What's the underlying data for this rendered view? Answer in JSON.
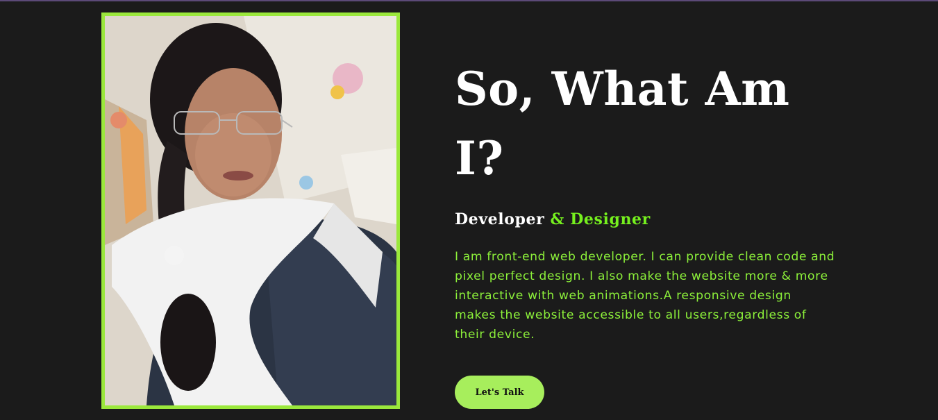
{
  "about": {
    "heading": "So, What Am I?",
    "subtitle_white": "Developer",
    "subtitle_green": "& Designer",
    "description": "I am front-end web developer. I can provide clean code and pixel perfect design. I also make the website more & more interactive with web animations.A responsive design makes the website accessible to all users,regardless of their device.",
    "cta_label": "Let's Talk"
  },
  "colors": {
    "background": "#1b1b1b",
    "accent_green": "#76f01e",
    "frame_green": "#9be83c",
    "button_green": "#a7ee5c",
    "heading_white": "#ffffff"
  },
  "icons": {
    "photo": "profile-photo"
  }
}
